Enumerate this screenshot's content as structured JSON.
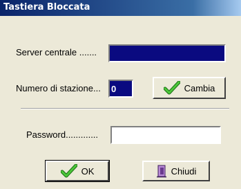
{
  "window": {
    "title": "Tastiera Bloccata"
  },
  "server": {
    "label": "Server centrale .......",
    "value": ""
  },
  "station": {
    "label": "Numero di stazione...",
    "value": "0"
  },
  "buttons": {
    "cambia_label": "Cambia",
    "ok_label": "OK",
    "chiudi_label": "Chiudi"
  },
  "password": {
    "label": "Password.............",
    "value": ""
  },
  "icons": {
    "cambia": "checkmark-icon",
    "ok": "checkmark-icon",
    "chiudi": "door-exit-icon"
  },
  "colors": {
    "titlebar": "#0a246a",
    "field_selected_bg": "#0a0a80",
    "window_bg": "#ece9d8",
    "check_green": "#2e9a1f",
    "door_purple": "#6a3b8f"
  }
}
